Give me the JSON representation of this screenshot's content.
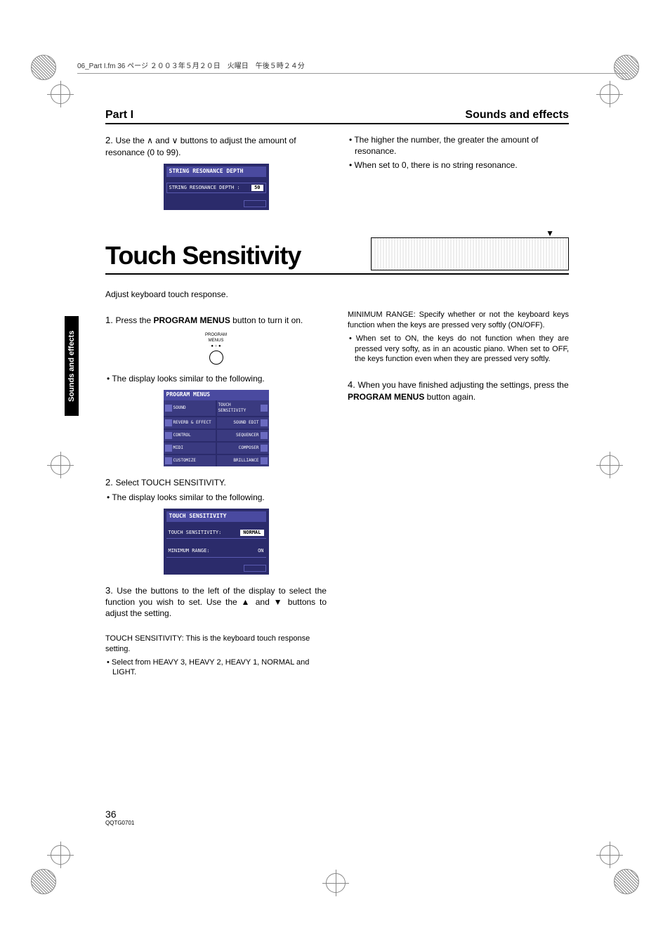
{
  "header": {
    "print_info": "06_Part I.fm 36 ページ ２００３年５月２０日　火曜日　午後５時２４分"
  },
  "titles": {
    "part": "Part I",
    "section": "Sounds and effects"
  },
  "side_tab": "Sounds and effects",
  "string_resonance": {
    "step2": "Use the ∧ and ∨ buttons to adjust the amount of resonance (0 to 99).",
    "screen_title": "STRING RESONANCE DEPTH",
    "screen_field": "STRING RESONANCE DEPTH :",
    "screen_value": "50",
    "note1": "The higher the number, the greater the amount of resonance.",
    "note2": "When set to 0, there is no string resonance."
  },
  "touch": {
    "heading": "Touch Sensitivity",
    "intro": "Adjust keyboard touch response.",
    "step1_a": "Press the ",
    "step1_bold": "PROGRAM MENUS",
    "step1_b": " button to turn it on.",
    "button_label": "PROGRAM MENUS",
    "display_note": "The display looks similar to the following.",
    "menu_title": "PROGRAM MENUS",
    "menu_items_left": [
      "SOUND",
      "REVERB & EFFECT",
      "CONTROL",
      "MIDI",
      "CUSTOMIZE"
    ],
    "menu_items_right": [
      "TOUCH SENSITIVITY",
      "SOUND EDIT",
      "SEQUENCER",
      "COMPOSER",
      "BRILLIANCE"
    ],
    "step2": "Select TOUCH SENSITIVITY.",
    "ts_screen_title": "TOUCH SENSITIVITY",
    "ts_field1": "TOUCH SENSITIVITY:",
    "ts_val1": "NORMAL",
    "ts_field2": "MINIMUM RANGE:",
    "ts_val2": "ON",
    "step3": "Use the buttons to the left of the display to select the function you wish to set. Use the ▲ and ▼ buttons to adjust the setting.",
    "ts_desc": "TOUCH SENSITIVITY: This is the keyboard touch response setting.",
    "ts_options": "Select from HEAVY 3, HEAVY 2, HEAVY 1, NORMAL and LIGHT.",
    "min_range_desc": "MINIMUM RANGE: Specify whether or not the keyboard keys function when the keys are pressed very softly (ON/OFF).",
    "min_range_note": "When set to ON, the keys do not function when they are pressed very softy, as in an acoustic piano. When set to OFF, the keys function even when they are pressed very softly.",
    "step4_a": "When you have finished adjusting the settings, press the ",
    "step4_bold": "PROGRAM MENUS",
    "step4_b": " button again."
  },
  "footer": {
    "page": "36",
    "doc": "QQTG0701"
  }
}
